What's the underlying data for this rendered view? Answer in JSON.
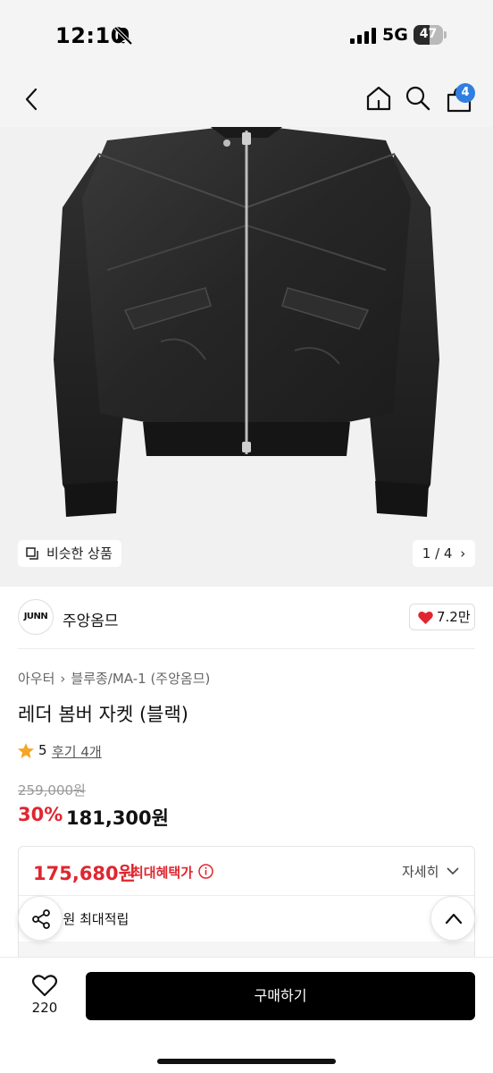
{
  "status_bar": {
    "time": "12:10",
    "network": "5G",
    "battery": "47",
    "icons": [
      "bell-slash-icon",
      "signal-icon",
      "battery-icon"
    ]
  },
  "header": {
    "icons": [
      "back-icon",
      "home-icon",
      "search-icon",
      "cart-icon"
    ],
    "cart_count": "4"
  },
  "gallery": {
    "similar_label": "비슷한 상품",
    "page_indicator": "1 / 4"
  },
  "brand": {
    "logo_text": "JUNN",
    "name": "주앙옴므",
    "likes": "7.2만"
  },
  "breadcrumb": {
    "category": "아우터",
    "subcategory": "블루종/MA-1 (주앙옴므)"
  },
  "product": {
    "title": "레더 봄버 자켓 (블랙)",
    "rating": "5",
    "review_label": "후기 4개",
    "original_price": "259,000원",
    "discount": "30%",
    "sale_price": "181,300원"
  },
  "benefit": {
    "max_price": "175,680원",
    "max_label": "최대혜택가",
    "detail_label": "자세히",
    "points_text": "0원 최대적립"
  },
  "bottom": {
    "wish_count": "220",
    "buy_label": "구매하기"
  },
  "colors": {
    "accent_red": "#e0262f",
    "badge_blue": "#2f7fe0",
    "buy_button": "#000000"
  }
}
